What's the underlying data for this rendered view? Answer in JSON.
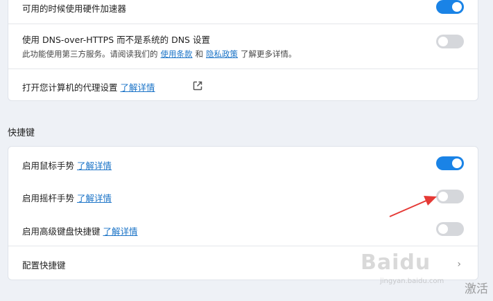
{
  "top_card": {
    "hw_label": "可用的时候使用硬件加速器",
    "hw_on": true,
    "doh_label": "使用 DNS-over-HTTPS 而不是系统的 DNS 设置",
    "doh_on": false,
    "doh_sub_prefix": "此功能使用第三方服务。请阅读我们的",
    "doh_terms_link": "使用条款",
    "doh_and": "和",
    "doh_privacy_link": "隐私政策",
    "doh_sub_suffix": "了解更多详情。",
    "proxy_label": "打开您计算机的代理设置",
    "proxy_link": "了解详情",
    "proxy_icon": "external-link-icon"
  },
  "shortcuts": {
    "section_title": "快捷键",
    "mouse_label": "启用鼠标手势",
    "mouse_link": "了解详情",
    "mouse_on": true,
    "rocker_label": "启用摇杆手势",
    "rocker_link": "了解详情",
    "rocker_on": false,
    "advanced_label": "启用高级键盘快捷键",
    "advanced_link": "了解详情",
    "advanced_on": false,
    "configure_label": "配置快捷键",
    "configure_icon": "chevron-right-icon"
  },
  "annotation": {
    "arrow_color": "#e53935"
  },
  "colors": {
    "toggle_on": "#1a83e6",
    "toggle_off": "#d5d7db",
    "link": "#1a73c7"
  },
  "watermark": {
    "brand": "Baidu",
    "sub": "jingyan.baidu.com",
    "corner": "激活"
  }
}
